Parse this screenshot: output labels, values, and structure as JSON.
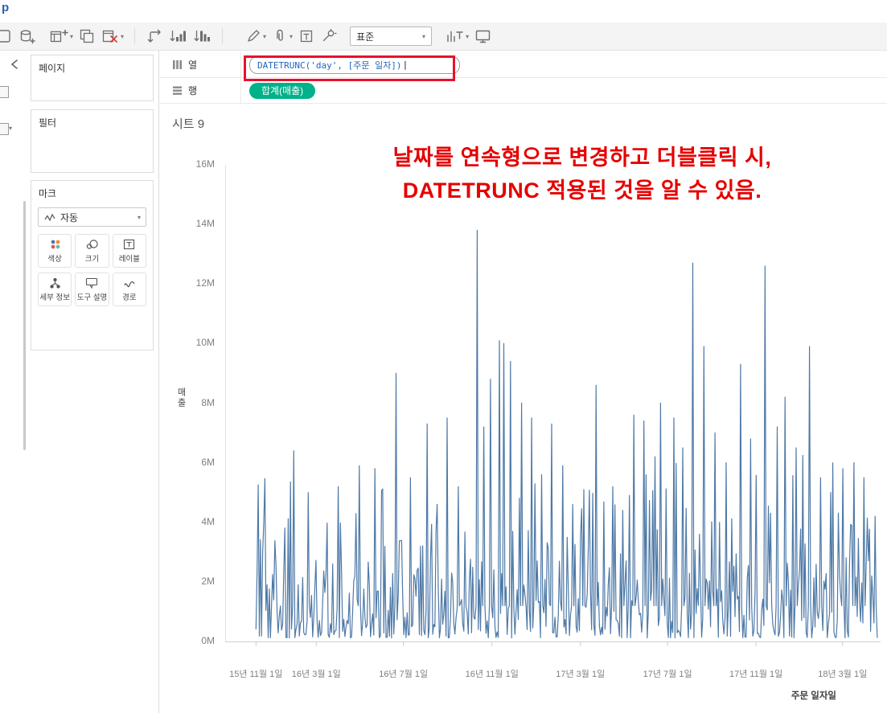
{
  "window": {
    "title_fragment": "p"
  },
  "toolbar": {
    "fit_value": "표준",
    "icons": [
      "clipped-toolbar-icon",
      "new-data-source",
      "new-worksheet",
      "duplicate-sheet",
      "clear-sheet",
      "swap-axes",
      "sort-ascending",
      "sort-descending",
      "highlight-pen",
      "group-members",
      "text-label",
      "fix-axes-pin",
      "fit-dropdown",
      "show-mark-labels",
      "presentation-mode"
    ]
  },
  "panels": {
    "pages": {
      "title": "페이지"
    },
    "filters": {
      "title": "필터"
    },
    "marks": {
      "title": "마크",
      "mark_type": "자동",
      "buttons": [
        {
          "label": "색상"
        },
        {
          "label": "크기"
        },
        {
          "label": "레이블"
        },
        {
          "label": "세부 정보"
        },
        {
          "label": "도구 설명"
        },
        {
          "label": "경로"
        }
      ]
    }
  },
  "shelves": {
    "columns": {
      "label": "열",
      "field_text": "DATETRUNC('day', [주문 일자])",
      "text_color": "#2166c0",
      "highlight_color": "#e8112d"
    },
    "rows": {
      "label": "행",
      "pill": "합계(매출)",
      "pill_color": "#00b18a"
    }
  },
  "sheet": {
    "title": "시트 9",
    "annotation": {
      "line1": "날짜를 연속형으로 변경하고 더블클릭 시,",
      "line2": "DATETRUNC 적용된 것을 알 수 있음.",
      "color": "#e60000"
    }
  },
  "chart_data": {
    "type": "line",
    "title": "시트 9",
    "ylabel": "매출",
    "xlabel": "주문 일자일",
    "ylim": [
      0,
      16
    ],
    "y_unit": "M",
    "y_tick_labels": [
      "0M",
      "2M",
      "4M",
      "6M",
      "8M",
      "10M",
      "12M",
      "14M",
      "16M"
    ],
    "x_tick_labels": [
      "15년 11월 1일",
      "16년 3월 1일",
      "16년 7월 1일",
      "16년 11월 1일",
      "17년 3월 1일",
      "17년 7월 1일",
      "17년 11월 1일",
      "18년 3월 1일"
    ],
    "x_tick_fractions": [
      0.047,
      0.139,
      0.272,
      0.407,
      0.542,
      0.675,
      0.81,
      0.942
    ],
    "line_color": "#4e79a7",
    "grid": false,
    "legend": false,
    "n_points": 560,
    "x_start_f": 0.047,
    "x_end_f": 0.995,
    "seed": 20151101,
    "peaks": [
      [
        0.104,
        6.4
      ],
      [
        0.126,
        5.0
      ],
      [
        0.172,
        5.2
      ],
      [
        0.205,
        5.9
      ],
      [
        0.228,
        5.8
      ],
      [
        0.26,
        9.0
      ],
      [
        0.282,
        5.5
      ],
      [
        0.309,
        7.3
      ],
      [
        0.339,
        7.5
      ],
      [
        0.356,
        5.2
      ],
      [
        0.385,
        13.8
      ],
      [
        0.395,
        7.2
      ],
      [
        0.405,
        8.8
      ],
      [
        0.418,
        10.1
      ],
      [
        0.426,
        10.0
      ],
      [
        0.436,
        9.4
      ],
      [
        0.452,
        8.0
      ],
      [
        0.467,
        7.5
      ],
      [
        0.482,
        5.6
      ],
      [
        0.498,
        7.3
      ],
      [
        0.515,
        5.9
      ],
      [
        0.531,
        4.6
      ],
      [
        0.548,
        5.1
      ],
      [
        0.566,
        8.6
      ],
      [
        0.591,
        5.2
      ],
      [
        0.607,
        4.4
      ],
      [
        0.624,
        7.6
      ],
      [
        0.639,
        7.4
      ],
      [
        0.655,
        6.2
      ],
      [
        0.664,
        8.0
      ],
      [
        0.685,
        7.5
      ],
      [
        0.699,
        6.5
      ],
      [
        0.714,
        12.7
      ],
      [
        0.731,
        9.9
      ],
      [
        0.748,
        7.0
      ],
      [
        0.764,
        6.0
      ],
      [
        0.786,
        9.3
      ],
      [
        0.802,
        6.8
      ],
      [
        0.823,
        12.6
      ],
      [
        0.842,
        7.2
      ],
      [
        0.854,
        8.2
      ],
      [
        0.871,
        6.5
      ],
      [
        0.891,
        9.9
      ],
      [
        0.908,
        5.5
      ],
      [
        0.923,
        5.0
      ],
      [
        0.942,
        5.8
      ],
      [
        0.959,
        6.0
      ],
      [
        0.975,
        5.5
      ],
      [
        0.991,
        4.2
      ]
    ]
  }
}
